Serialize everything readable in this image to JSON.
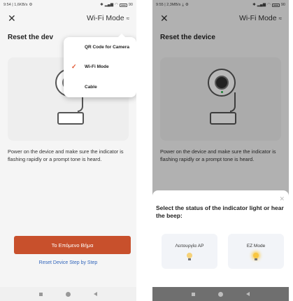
{
  "left_screen": {
    "status": {
      "time_info": "9:54 | 1,6KB/s",
      "battery": "90"
    },
    "nav": {
      "title": "Wi-Fi Mode"
    },
    "heading": "Reset the dev",
    "description": "Power on the device and make sure the indicator is flashing rapidly or a prompt tone is heard.",
    "primary_button": "Το Επόμενο Βήμα",
    "link": "Reset Device Step by Step",
    "dropdown": {
      "items": [
        {
          "label": "QR Code for Camera",
          "selected": false
        },
        {
          "label": "Wi-Fi Mode",
          "selected": true
        },
        {
          "label": "Cable",
          "selected": false
        }
      ]
    }
  },
  "right_screen": {
    "status": {
      "time_info": "9:55 | 2,3MB/s",
      "battery": "90"
    },
    "nav": {
      "title": "Wi-Fi Mode"
    },
    "heading": "Reset the device",
    "description": "Power on the device and make sure the indicator is flashing rapidly or a prompt tone is heard.",
    "sheet": {
      "title": "Select the status of the indicator light or hear the beep:",
      "options": [
        {
          "label": "Λειτουργία AP"
        },
        {
          "label": "EZ Mode"
        }
      ]
    }
  },
  "colors": {
    "primary": "#c8502c",
    "link": "#3366bb",
    "check": "#e0512c"
  },
  "icons": {
    "close": "close-icon",
    "mode": "wifi-mode-icon",
    "check": "check-icon",
    "bulb": "light-bulb-icon"
  }
}
